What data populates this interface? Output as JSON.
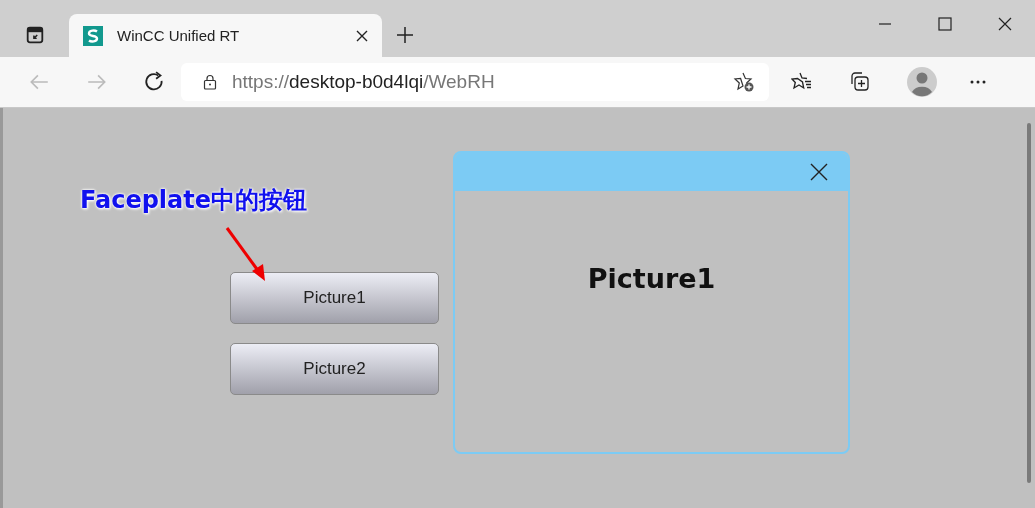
{
  "browser": {
    "tab": {
      "title": "WinCC Unified RT",
      "selected": true
    },
    "address": {
      "scheme": "https://",
      "host": "desktop-b0d4lqi",
      "path": "/WebRH"
    }
  },
  "annotation": "Faceplate中的按钮",
  "buttons": [
    "Picture1",
    "Picture2"
  ],
  "faceplate": {
    "content": "Picture1"
  }
}
